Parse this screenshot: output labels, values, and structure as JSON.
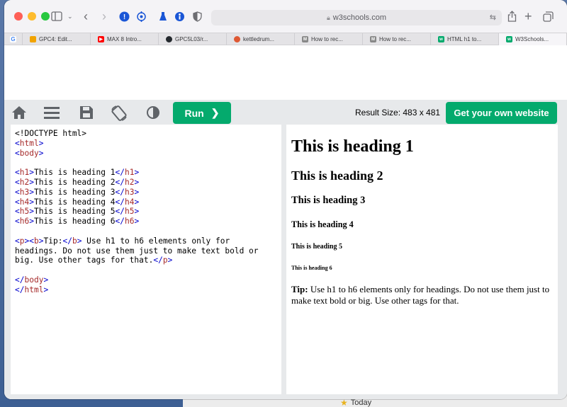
{
  "browser": {
    "url": "w3schools.com",
    "tabs": [
      {
        "label": "",
        "icon": "google-icon",
        "color": "#4285f4"
      },
      {
        "label": "GPC4: Edit...",
        "icon": "gpc-icon",
        "color": "#f1a300"
      },
      {
        "label": "MAX 8 Intro...",
        "icon": "youtube-icon",
        "color": "#ff0000"
      },
      {
        "label": "GPC5L03/r...",
        "icon": "github-icon",
        "color": "#24292e"
      },
      {
        "label": "kettledrum...",
        "icon": "duckduckgo-icon",
        "color": "#de5833"
      },
      {
        "label": "How to rec...",
        "icon": "medium-icon",
        "color": "#888888"
      },
      {
        "label": "How to rec...",
        "icon": "medium-icon",
        "color": "#888888"
      },
      {
        "label": "HTML h1 to...",
        "icon": "w3schools-icon",
        "color": "#04aa6d"
      },
      {
        "label": "W3Schools...",
        "icon": "w3schools-icon",
        "color": "#04aa6d"
      }
    ]
  },
  "toolbar": {
    "run_label": "Run",
    "result_size": "Result Size: 483 x 481",
    "get_website_label": "Get your own website"
  },
  "editor": {
    "lines": [
      "<!DOCTYPE html>",
      "<html>",
      "<body>",
      "",
      "<h1>This is heading 1</h1>",
      "<h2>This is heading 2</h2>",
      "<h3>This is heading 3</h3>",
      "<h4>This is heading 4</h4>",
      "<h5>This is heading 5</h5>",
      "<h6>This is heading 6</h6>",
      "",
      "<p><b>Tip:</b> Use h1 to h6 elements only for",
      "headings. Do not use them just to make text bold or",
      "big. Use other tags for that.</p>",
      "",
      "</body>",
      "</html>"
    ]
  },
  "result": {
    "h1": "This is heading 1",
    "h2": "This is heading 2",
    "h3": "This is heading 3",
    "h4": "This is heading 4",
    "h5": "This is heading 5",
    "h6": "This is heading 6",
    "tip_label": "Tip:",
    "tip_text": " Use h1 to h6 elements only for headings. Do not use them just to make text bold or big. Use other tags for that."
  },
  "desktop": {
    "today_label": "Today"
  }
}
